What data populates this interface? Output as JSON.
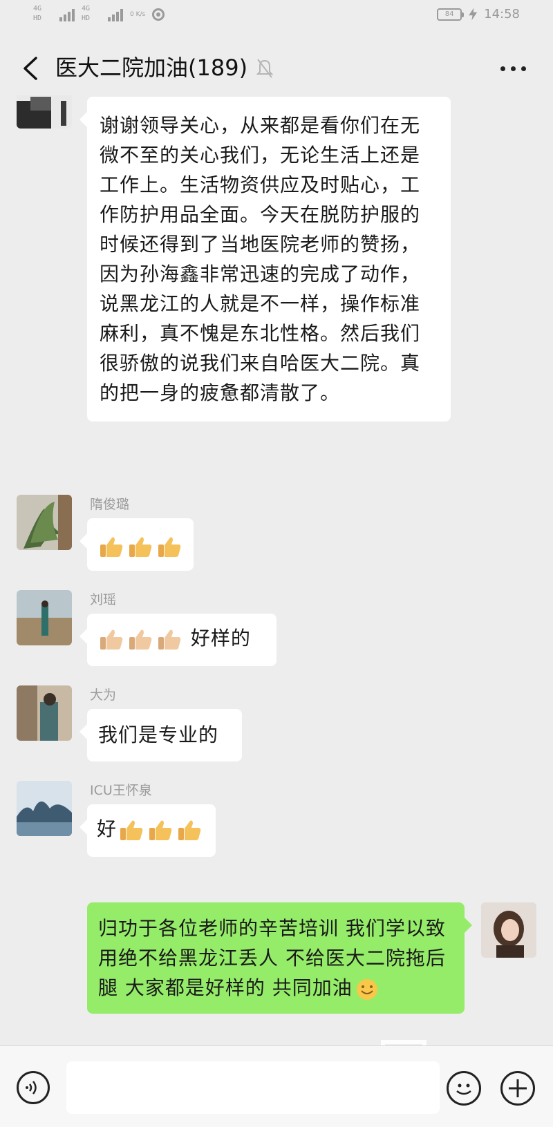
{
  "status_bar": {
    "sim_labels": [
      "4G HD",
      "4G HD"
    ],
    "speed": "0 K/s",
    "battery": "84",
    "time": "14:58"
  },
  "header": {
    "title": "医大二院加油(189)",
    "icons": {
      "back": "chevron-left-icon",
      "mute": "bell-off-icon",
      "more": "more-dots-icon"
    }
  },
  "messages": [
    {
      "sender": "",
      "text": "谢谢领导关心，从来都是看你们在无微不至的关心我们，无论生活上还是工作上。生活物资供应及时贴心，工作防护用品全面。今天在脱防护服的时候还得到了当地医院老师的赞扬，因为孙海鑫非常迅速的完成了动作，说黑龙江的人就是不一样，操作标准麻利，真不愧是东北性格。然后我们很骄傲的说我们来自哈医大二院。真的把一身的疲惫都清散了。"
    },
    {
      "sender": "隋俊璐",
      "text": "",
      "thumbs": 3
    },
    {
      "sender": "刘瑶",
      "text": "好样的",
      "thumbs": 3
    },
    {
      "sender": "大为",
      "text": "我们是专业的"
    },
    {
      "sender": "ICU王怀泉",
      "text": "好",
      "thumbs": 3
    },
    {
      "sender": "",
      "own": true,
      "text": "归功于各位老师的辛苦培训 我们学以致用绝不给黑龙江丢人  不给医大二院拖后腿  大家都是好样的 共同加油"
    }
  ],
  "input_bar": {
    "placeholder": "",
    "icons": {
      "voice": "voice-icon",
      "emoji": "emoji-icon",
      "plus": "plus-icon"
    }
  },
  "colors": {
    "background": "#ededed",
    "bubble_other": "#ffffff",
    "bubble_own": "#95ec69",
    "sender_name": "#9b9b9b"
  }
}
